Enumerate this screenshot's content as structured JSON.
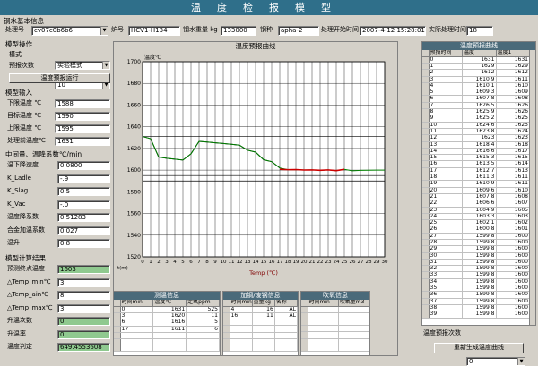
{
  "app": {
    "title": "温度检报模型"
  },
  "basic": {
    "section": "钢水基本信息",
    "ladle_label": "处理号",
    "ladle_value": "cv07c0b6b6",
    "heat_label": "炉号",
    "heat_value": "HCV1-H134",
    "weight_label": "钢水重量 kg",
    "weight_value": "133000",
    "steel_label": "钢种",
    "steel_value": "apha-2",
    "start_label": "处理开始时间",
    "start_value": "2007-4-12 15:28:01",
    "elapsed_label": "实际处理时间",
    "elapsed_value": "18"
  },
  "model_ops": {
    "section": "模型操作",
    "mode_label": "模式",
    "mode_value": "实验模式",
    "times_label": "预报次数",
    "times_value": "10",
    "run_button": "温度预报运行"
  },
  "model_input": {
    "section": "模型输入",
    "fields": [
      {
        "label": "下限温度 ℃",
        "value": "1588"
      },
      {
        "label": "目标温度 ℃",
        "value": "1590"
      },
      {
        "label": "上限温度 ℃",
        "value": "1595"
      },
      {
        "label": "处理前温度℃",
        "value": "1631"
      }
    ]
  },
  "params": {
    "section": "中间量、温降系数℃/min",
    "fields": [
      {
        "label": "温下降速度",
        "value": "0.0800"
      },
      {
        "label": "K_Ladle",
        "value": "-.9"
      },
      {
        "label": "K_Slag",
        "value": "0.5"
      },
      {
        "label": "K_Vac",
        "value": "-.0"
      },
      {
        "label": "温度降系数",
        "value": "0.51283"
      },
      {
        "label": "合金加温系数",
        "value": "0.027"
      },
      {
        "label": "温升",
        "value": "0.8"
      }
    ]
  },
  "results": {
    "section": "模型计算结果",
    "fields": [
      {
        "label": "预测终点温度",
        "value": "1603",
        "green": true
      },
      {
        "label": "△Temp_min℃",
        "value": "3",
        "green": false
      },
      {
        "label": "△Temp_ain℃",
        "value": "8",
        "green": false
      },
      {
        "label": "△Temp_max℃",
        "value": "3",
        "green": false
      },
      {
        "label": "升温次数",
        "value": "0",
        "green": true
      },
      {
        "label": "升温率",
        "value": "0",
        "green": true
      },
      {
        "label": "温度判定",
        "value": "649.4553608",
        "green": true
      }
    ]
  },
  "chart": {
    "title": "温度预报曲线"
  },
  "chart_data": {
    "type": "line",
    "title": "温度预报曲线",
    "ylabel": "温度℃",
    "xlabel": "Temp (℃)",
    "ylim": [
      1520,
      1700
    ],
    "xlim": [
      0,
      30
    ],
    "yticks": [
      1520,
      1540,
      1560,
      1580,
      1600,
      1620,
      1640,
      1660,
      1680,
      1700
    ],
    "xticks": [
      0,
      1,
      2,
      3,
      4,
      5,
      6,
      7,
      8,
      9,
      10,
      11,
      12,
      13,
      14,
      15,
      16,
      17,
      18,
      19,
      20,
      21,
      22,
      23,
      24,
      25,
      26,
      27,
      28,
      29,
      30
    ],
    "x_unit_label": "t(m)",
    "grid": true,
    "reference_lines": [
      1588,
      1590,
      1595,
      1631
    ],
    "series": [
      {
        "color": "#000000",
        "x": [
          0,
          1,
          2,
          3,
          4,
          5,
          6,
          7,
          8,
          9,
          10,
          11,
          12,
          13,
          14,
          15,
          16,
          17
        ],
        "values": [
          1631,
          1629,
          1612,
          1610.9,
          1610.1,
          1609.3,
          1615,
          1626.5,
          1625.9,
          1625.2,
          1624.6,
          1623.8,
          1623,
          1618.4,
          1616.6,
          1609.6,
          1607.8,
          1602
        ]
      },
      {
        "color": "#008000",
        "x": [
          0,
          1,
          2,
          3,
          4,
          5,
          6,
          7,
          8,
          9,
          10,
          11,
          12,
          13,
          14,
          15,
          16,
          17,
          18,
          19,
          20,
          21,
          22,
          23,
          24,
          25,
          26,
          27,
          28,
          29,
          30
        ],
        "values": [
          1631,
          1629,
          1612,
          1610.9,
          1610.1,
          1609.3,
          1615,
          1626.5,
          1625.9,
          1625.2,
          1624.6,
          1623.8,
          1623,
          1618.4,
          1616.6,
          1609.6,
          1607.8,
          1602,
          1600.4,
          1600.5,
          1600.1,
          1600.2,
          1599.8,
          1600.2,
          1599.5,
          1600.7,
          1599.4,
          1599.8,
          1599.9,
          1600,
          1600
        ]
      },
      {
        "color": "#cc0000",
        "x": [
          17,
          18,
          19,
          20,
          21,
          22,
          23,
          24,
          25
        ],
        "values": [
          1600.8,
          1600.4,
          1600.5,
          1600.1,
          1600.2,
          1599.8,
          1600.2,
          1599.5,
          1600.7
        ]
      }
    ]
  },
  "right_table": {
    "title": "温度预报曲线",
    "headers": [
      "预报时间",
      "温度",
      "温度1"
    ],
    "rows": [
      [
        "0",
        "1631",
        "1631"
      ],
      [
        "1",
        "1629",
        "1629"
      ],
      [
        "2",
        "1612",
        "1612"
      ],
      [
        "3",
        "1610.9",
        "1611"
      ],
      [
        "4",
        "1610.1",
        "1610"
      ],
      [
        "5",
        "1609.3",
        "1609"
      ],
      [
        "6",
        "1607.8",
        "1608"
      ],
      [
        "7",
        "1626.5",
        "1626"
      ],
      [
        "8",
        "1625.9",
        "1626"
      ],
      [
        "9",
        "1625.2",
        "1625"
      ],
      [
        "10",
        "1624.6",
        "1625"
      ],
      [
        "11",
        "1623.8",
        "1624"
      ],
      [
        "12",
        "1623",
        "1623"
      ],
      [
        "13",
        "1618.4",
        "1618"
      ],
      [
        "14",
        "1616.6",
        "1617"
      ],
      [
        "15",
        "1615.3",
        "1615"
      ],
      [
        "16",
        "1613.5",
        "1614"
      ],
      [
        "17",
        "1612.7",
        "1613"
      ],
      [
        "18",
        "1611.3",
        "1611"
      ],
      [
        "19",
        "1610.9",
        "1611"
      ],
      [
        "20",
        "1609.6",
        "1610"
      ],
      [
        "21",
        "1607.8",
        "1608"
      ],
      [
        "22",
        "1606.6",
        "1607"
      ],
      [
        "23",
        "1604.9",
        "1605"
      ],
      [
        "24",
        "1603.3",
        "1603"
      ],
      [
        "25",
        "1602.1",
        "1602"
      ],
      [
        "26",
        "1600.8",
        "1601"
      ],
      [
        "27",
        "1599.8",
        "1600"
      ],
      [
        "28",
        "1599.8",
        "1600"
      ],
      [
        "29",
        "1599.8",
        "1600"
      ],
      [
        "30",
        "1599.8",
        "1600"
      ],
      [
        "31",
        "1599.8",
        "1600"
      ],
      [
        "32",
        "1599.8",
        "1600"
      ],
      [
        "33",
        "1599.8",
        "1600"
      ],
      [
        "34",
        "1599.8",
        "1600"
      ],
      [
        "35",
        "1599.8",
        "1600"
      ],
      [
        "36",
        "1599.8",
        "1600"
      ],
      [
        "37",
        "1599.8",
        "1600"
      ],
      [
        "38",
        "1599.8",
        "1600"
      ],
      [
        "39",
        "1599.8",
        "1600"
      ]
    ],
    "page_label": "温度预报次数",
    "page_value": "0",
    "generate_button": "重新生成温度曲线"
  },
  "measure": {
    "title": "测温信息",
    "headers": [
      "时间min",
      "温度℃",
      "定氧ppm"
    ],
    "rows": [
      [
        "0",
        "1631",
        "525"
      ],
      [
        "3",
        "1620",
        "11"
      ],
      [
        "6",
        "1616",
        "5"
      ],
      [
        "17",
        "1611",
        "6"
      ]
    ]
  },
  "alloy": {
    "title": "加钢/废钢信息",
    "headers": [
      "时间min",
      "重量kg",
      "名称"
    ],
    "rows": [
      [
        "4",
        "16",
        "AL"
      ],
      [
        "16",
        "11",
        "AL"
      ]
    ]
  },
  "blow": {
    "title": "吹氧信息",
    "headers": [
      "时间min",
      "吹氧量m3"
    ],
    "rows": []
  }
}
